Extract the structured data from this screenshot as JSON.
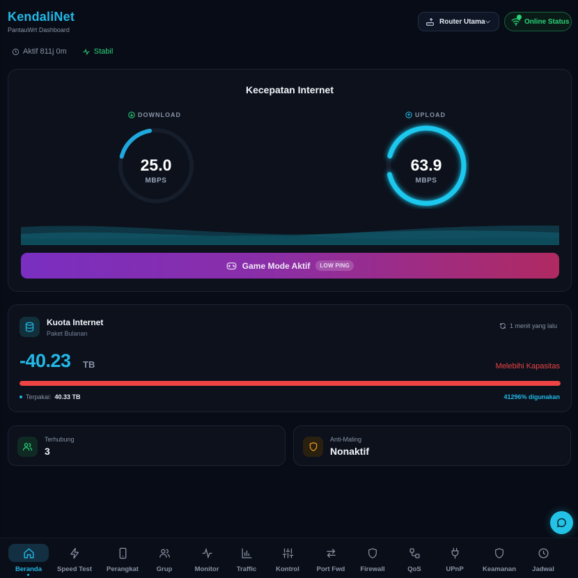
{
  "brand": {
    "title": "KendaliNet",
    "subtitle": "PantauWrt Dashboard"
  },
  "header": {
    "router_label": "Router Utama",
    "status_label": "Online Status"
  },
  "meta": {
    "uptime": "Aktif 811j 0m",
    "stability": "Stabil"
  },
  "speed": {
    "title": "Kecepatan Internet",
    "download": {
      "label": "DOWNLOAD",
      "value": "25.0",
      "unit": "MBPS",
      "fill": 0.18
    },
    "upload": {
      "label": "UPLOAD",
      "value": "63.9",
      "unit": "MBPS",
      "fill": 0.92
    },
    "game_mode": {
      "label": "Game Mode Aktif",
      "badge": "LOW PING"
    }
  },
  "quota": {
    "title": "Kuota Internet",
    "subtitle": "Paket Bulanan",
    "updated": "1 menit yang lalu",
    "value": "-40.23",
    "unit": "TB",
    "status": "Melebihi Kapasitas",
    "used_label": "Terpakai:",
    "used_value": "40.33 TB",
    "percent": "41296% digunakan",
    "fill": 1.0
  },
  "stats": {
    "connected": {
      "label": "Terhubung",
      "value": "3"
    },
    "antitheft": {
      "label": "Anti-Maling",
      "value": "Nonaktif"
    }
  },
  "nav": [
    {
      "label": "Beranda",
      "icon": "home-icon",
      "active": true
    },
    {
      "label": "Speed Test",
      "icon": "bolt-icon"
    },
    {
      "label": "Perangkat",
      "icon": "phone-icon"
    },
    {
      "label": "Grup",
      "icon": "users-icon"
    },
    {
      "label": "Monitor",
      "icon": "pulse-icon"
    },
    {
      "label": "Traffic",
      "icon": "bar-chart-icon"
    },
    {
      "label": "Kontrol",
      "icon": "sliders-icon"
    },
    {
      "label": "Port Fwd",
      "icon": "arrows-icon"
    },
    {
      "label": "Firewall",
      "icon": "shield-icon"
    },
    {
      "label": "QoS",
      "icon": "network-icon"
    },
    {
      "label": "UPnP",
      "icon": "plug-icon"
    },
    {
      "label": "Keamanan",
      "icon": "shield-icon"
    },
    {
      "label": "Jadwal",
      "icon": "clock-icon"
    }
  ],
  "colors": {
    "accent": "#22b8e6",
    "success": "#2bd47a",
    "danger": "#ef4444"
  }
}
